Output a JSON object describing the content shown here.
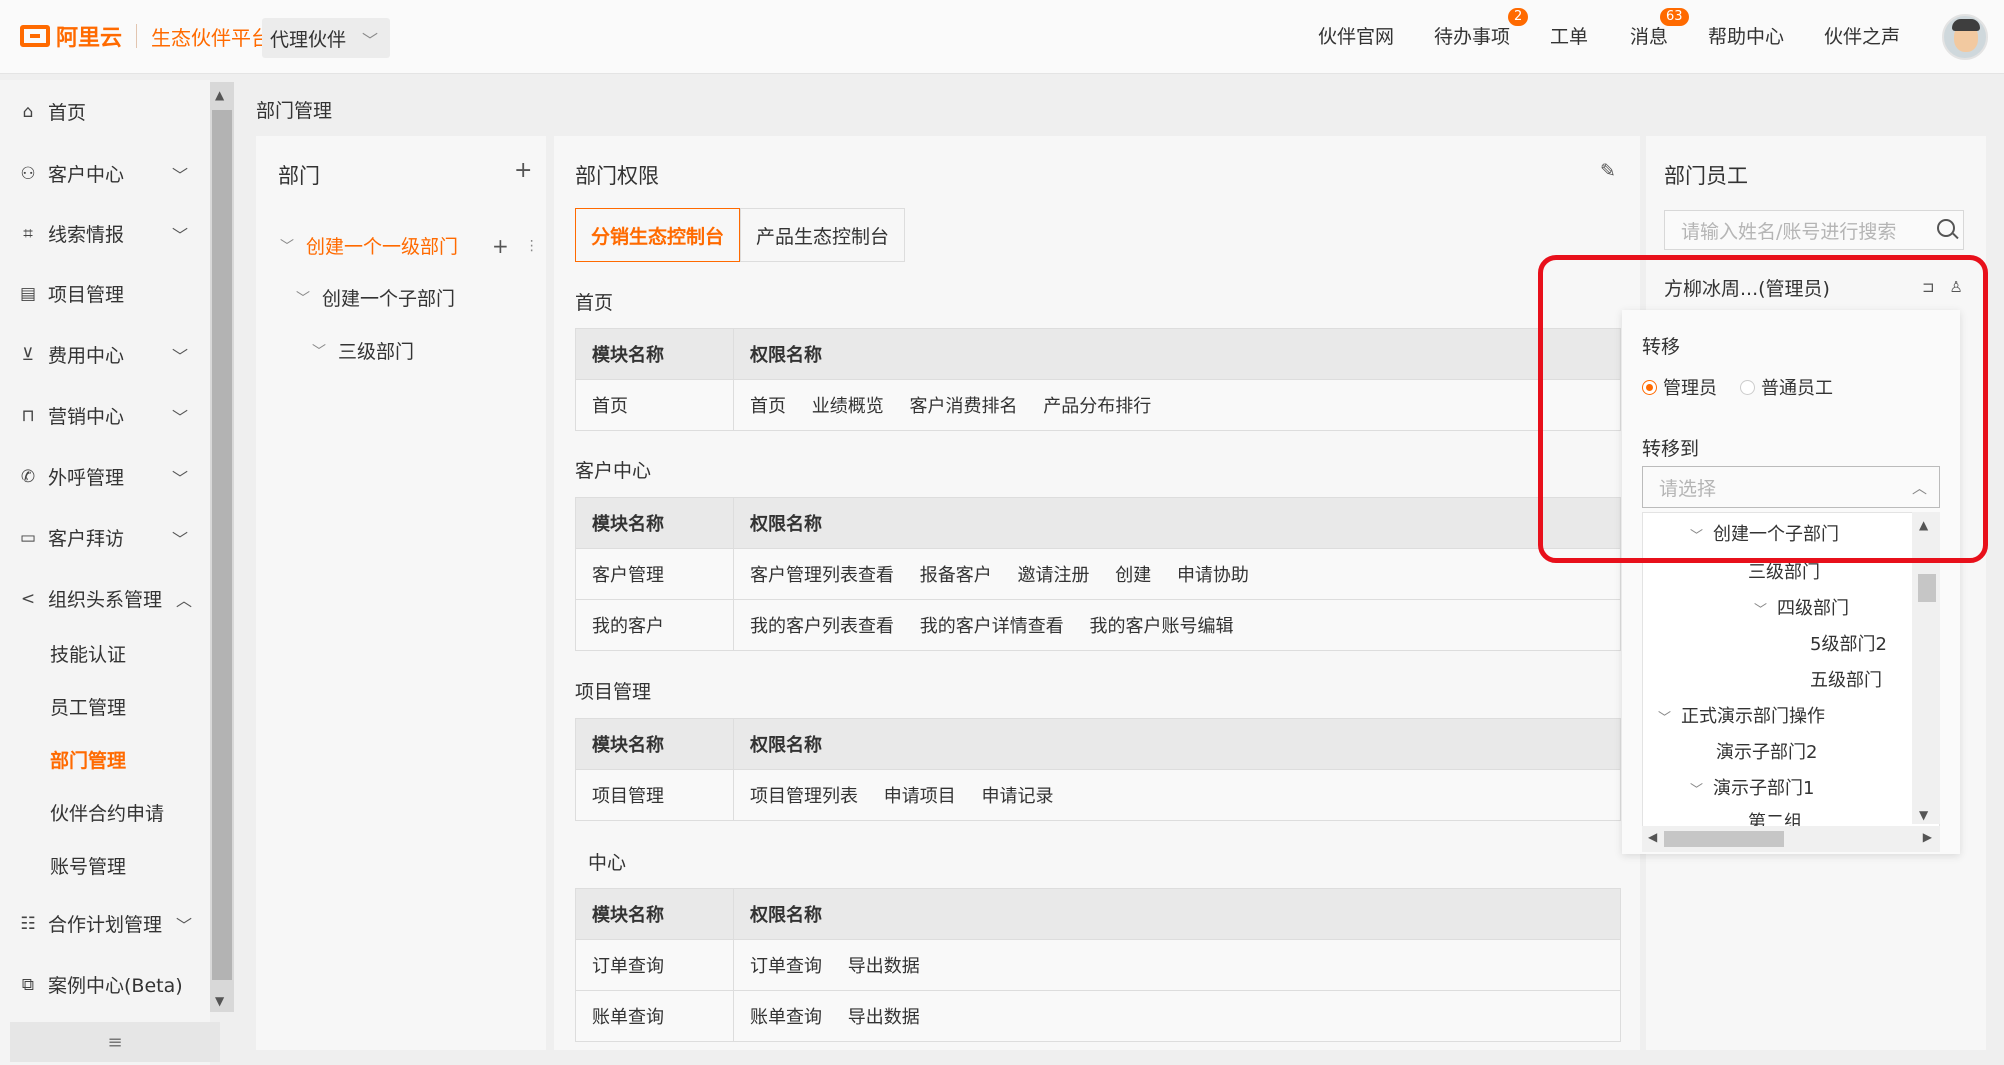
{
  "header": {
    "brand": "阿里云",
    "platform": "生态伙伴平台",
    "partner_select": "代理伙伴",
    "nav": [
      {
        "label": "伙伴官网",
        "badge": ""
      },
      {
        "label": "待办事项",
        "badge": "2"
      },
      {
        "label": "工单",
        "badge": ""
      },
      {
        "label": "消息",
        "badge": "63"
      },
      {
        "label": "帮助中心",
        "badge": ""
      },
      {
        "label": "伙伴之声",
        "badge": ""
      }
    ]
  },
  "sidebar": {
    "items": [
      {
        "label": "首页",
        "icon": "home-icon"
      },
      {
        "label": "客户中心",
        "icon": "user-icon"
      },
      {
        "label": "线索情报",
        "icon": "frame-icon"
      },
      {
        "label": "项目管理",
        "icon": "doc-icon"
      },
      {
        "label": "费用中心",
        "icon": "chart-icon"
      },
      {
        "label": "营销中心",
        "icon": "bag-icon"
      },
      {
        "label": "外呼管理",
        "icon": "phone-icon"
      },
      {
        "label": "客户拜访",
        "icon": "calendar-icon"
      },
      {
        "label": "组织头系管理",
        "icon": "share-icon"
      }
    ],
    "sub_items": [
      "技能认证",
      "员工管理",
      "部门管理",
      "伙伴合约申请",
      "账号管理"
    ],
    "bottom_items": [
      {
        "label": "合作计划管理",
        "icon": "plan-icon"
      },
      {
        "label": "案例中心(Beta)",
        "icon": "case-icon"
      }
    ],
    "collapse_label": "≡"
  },
  "breadcrumb": "部门管理",
  "dept_panel": {
    "title": "部门",
    "add": "+",
    "tree": [
      "创建一个一级部门",
      "创建一个子部门",
      "三级部门"
    ]
  },
  "perm_panel": {
    "title": "部门权限",
    "tabs": [
      "分销生态控制台",
      "产品生态控制台"
    ],
    "sections": [
      {
        "title": "首页",
        "header": [
          "模块名称",
          "权限名称"
        ],
        "rows": [
          [
            "首页",
            [
              "首页",
              "业绩概览",
              "客户消费排名",
              "产品分布排行"
            ]
          ]
        ]
      },
      {
        "title": "客户中心",
        "header": [
          "模块名称",
          "权限名称"
        ],
        "rows": [
          [
            "客户管理",
            [
              "客户管理列表查看",
              "报备客户",
              "邀请注册",
              "创建",
              "申请协助"
            ]
          ],
          [
            "我的客户",
            [
              "我的客户列表查看",
              "我的客户详情查看",
              "我的客户账号编辑"
            ]
          ]
        ]
      },
      {
        "title": "项目管理",
        "header": [
          "模块名称",
          "权限名称"
        ],
        "rows": [
          [
            "项目管理",
            [
              "项目管理列表",
              "申请项目",
              "申请记录"
            ]
          ]
        ]
      },
      {
        "title": "中心",
        "header": [
          "模块名称",
          "权限名称"
        ],
        "rows": [
          [
            "订单查询",
            [
              "订单查询",
              "导出数据"
            ]
          ],
          [
            "账单查询",
            [
              "账单查询",
              "导出数据"
            ]
          ]
        ]
      }
    ]
  },
  "staff_panel": {
    "title": "部门员工",
    "search_placeholder": "请输入姓名/账号进行搜索",
    "member": "方柳冰周...(管理员)",
    "popup": {
      "transfer_label": "转移",
      "roles": [
        "管理员",
        "普通员工"
      ],
      "transfer_to_label": "转移到",
      "select_placeholder": "请选择",
      "options": [
        {
          "label": "创建一个子部门",
          "caret": true
        },
        {
          "label": "三级部门",
          "caret": false
        },
        {
          "label": "四级部门",
          "caret": true
        },
        {
          "label": "5级部门2",
          "caret": false
        },
        {
          "label": "五级部门",
          "caret": false
        },
        {
          "label": "正式演示部门操作",
          "caret": true
        },
        {
          "label": "演示子部门2",
          "caret": false
        },
        {
          "label": "演示子部门1",
          "caret": true
        },
        {
          "label": "第二组",
          "caret": false
        }
      ]
    }
  },
  "colors": {
    "accent": "#ff6a00",
    "highlight": "#e8101b"
  }
}
